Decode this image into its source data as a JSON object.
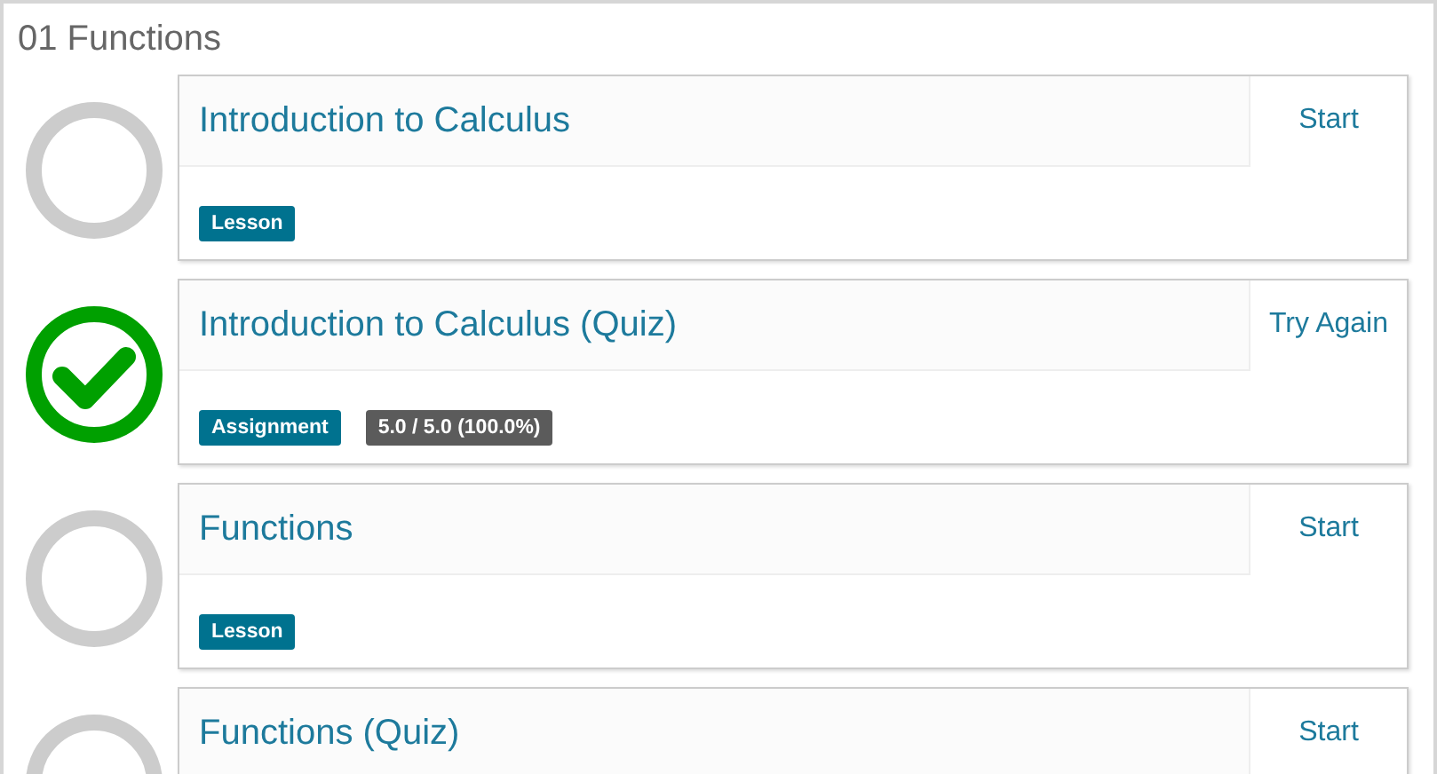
{
  "section": {
    "title": "01 Functions"
  },
  "items": [
    {
      "title": "Introduction to Calculus",
      "completed": false,
      "action": "Start",
      "tags": [
        {
          "kind": "type",
          "label": "Lesson"
        }
      ]
    },
    {
      "title": "Introduction to Calculus (Quiz)",
      "completed": true,
      "action": "Try Again",
      "tags": [
        {
          "kind": "type",
          "label": "Assignment"
        },
        {
          "kind": "score",
          "label": "5.0 / 5.0 (100.0%)"
        }
      ]
    },
    {
      "title": "Functions",
      "completed": false,
      "action": "Start",
      "tags": [
        {
          "kind": "type",
          "label": "Lesson"
        }
      ]
    },
    {
      "title": "Functions (Quiz)",
      "completed": false,
      "action": "Start"
    }
  ]
}
